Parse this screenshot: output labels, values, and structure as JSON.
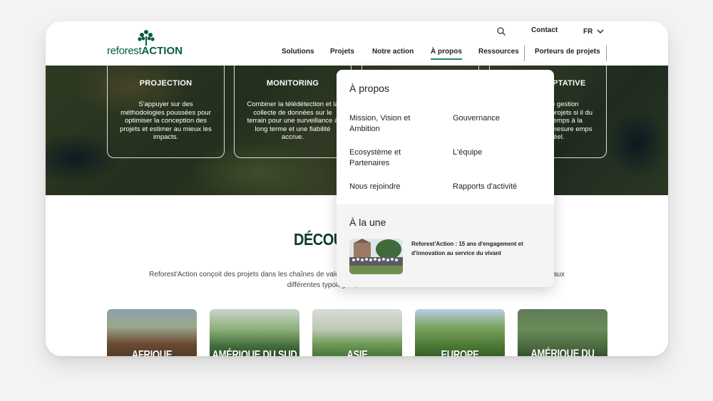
{
  "header": {
    "logo_text_light": "reforest",
    "logo_text_bold": "ACTION",
    "contact_label": "Contact",
    "language": "FR",
    "nav": [
      "Solutions",
      "Projets",
      "Notre action",
      "À propos",
      "Ressources",
      "Porteurs de projets"
    ],
    "active_nav": "À propos"
  },
  "hero": {
    "cards": [
      {
        "title": "PROJECTION",
        "text": "S'appuyer sur des méthodologies poussées pour optimiser la conception des projets et estimer au mieux les impacts."
      },
      {
        "title": "MONITORING",
        "text": "Combiner la télédétection et la collecte de données sur le terrain pour une surveillance à long terme et une fiabilité accrue."
      },
      {
        "title": "",
        "text": ""
      },
      {
        "title": "APTATIVE",
        "text": "e gestion projets si il du temps à la mesure emps réel."
      }
    ]
  },
  "dropdown": {
    "title": "À propos",
    "links": [
      "Mission, Vision et Ambition",
      "Gouvernance",
      "Ecosystème et Partenaires",
      "L'équipe",
      "Nous rejoindre",
      "Rapports d'activité"
    ],
    "featured_title": "À la une",
    "featured_text": "Reforest'Action : 15 ans d'engagement et d'innovation au service du vivant"
  },
  "section": {
    "title": "DÉCOUVI",
    "text_left": "Reforest'Action conçoit des projets dans les chaînes de valeur d",
    "text_right": "rojets aux",
    "text_line2": "différentes typologies, dans le monde entier."
  },
  "regions": [
    "AFRIQUE",
    "AMÉRIQUE DU SUD",
    "ASIE",
    "EUROPE",
    "AMÉRIQUE DU NORD"
  ],
  "colors": {
    "brand": "#0b5e3a",
    "accent": "#1e8a6a",
    "title": "#0f3a2b"
  }
}
